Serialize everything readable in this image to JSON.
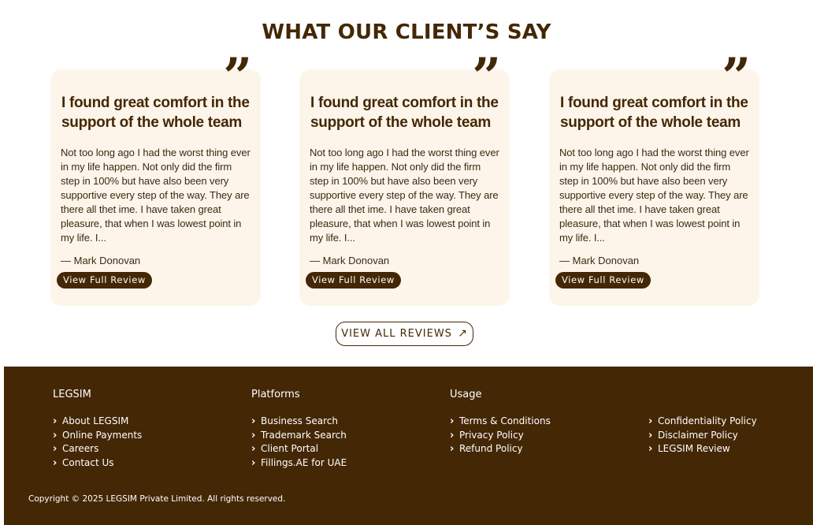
{
  "section": {
    "title": "WHAT OUR CLIENT’S SAY"
  },
  "testimonials": [
    {
      "title": "I found great comfort in the support of the whole team",
      "body": "Not too long ago I had the worst thing ever in my life happen. Not only did the firm step in 100% but have also been very supportive every step of the way. They are there all thet ime. I have taken great pleasure, that when I was lowest point in my life. I...",
      "author": "— Mark Donovan",
      "button": "View Full Review"
    },
    {
      "title": "I found great comfort in the support of the whole team",
      "body": "Not too long ago I had the worst thing ever in my life happen. Not only did the firm step in 100% but have also been very supportive every step of the way. They are there all thet ime. I have taken great pleasure, that when I was lowest point in my life. I...",
      "author": "— Mark Donovan",
      "button": "View Full Review"
    },
    {
      "title": "I found great comfort in the support of the whole team",
      "body": "Not too long ago I had the worst thing ever in my life happen. Not only did the firm step in 100% but have also been very supportive every step of the way. They are there all thet ime. I have taken great pleasure, that when I was lowest point in my life. I...",
      "author": "— Mark Donovan",
      "button": "View Full Review"
    }
  ],
  "quote_icon": "quote-icon",
  "view_all": {
    "label": "VIEW ALL REVIEWS",
    "icon": "arrow-up-right-icon"
  },
  "footer": {
    "columns": [
      {
        "heading": "LEGSIM",
        "links": [
          "About LEGSIM",
          "Online Payments",
          "Careers",
          "Contact Us"
        ]
      },
      {
        "heading": "Platforms",
        "links": [
          "Business Search",
          "Trademark Search",
          "Client Portal",
          "Fillings.AE for UAE"
        ]
      },
      {
        "heading": "Usage",
        "links": [
          "Terms & Conditions",
          "Privacy Policy",
          "Refund Policy"
        ]
      },
      {
        "heading": "",
        "links": [
          "Confidentiality Policy",
          "Disclaimer Policy",
          "LEGSIM Review"
        ]
      }
    ],
    "copyright": "Copyright © 2025 LEGSIM Private Limited. All rights reserved."
  },
  "colors": {
    "brand": "#442705",
    "card_bg": "#fdf5ea",
    "text": "#3b2a10"
  }
}
